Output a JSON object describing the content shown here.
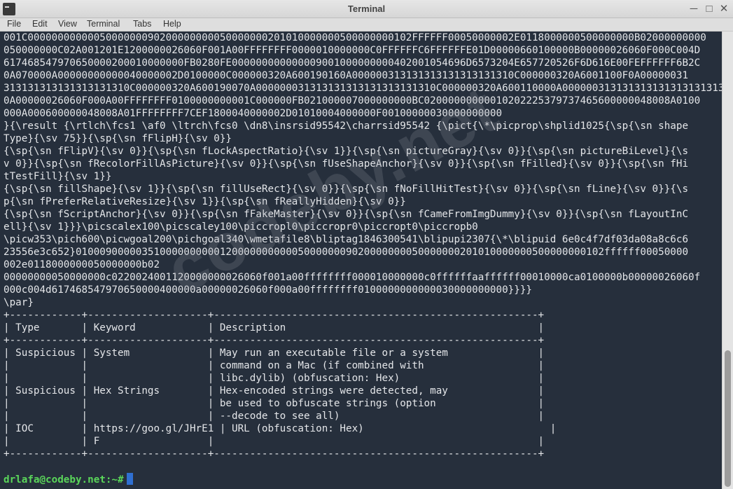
{
  "window": {
    "title": "Terminal",
    "controls": {
      "minimize": "─",
      "maximize": "□",
      "close": "✕"
    }
  },
  "menu": [
    "File",
    "Edit",
    "View",
    "Terminal",
    "Tabs",
    "Help"
  ],
  "terminal": {
    "lines": [
      "001C0000000000005000000090200000000050000000201010000000500000000102FFFFFF00050000002E0118000000500000000B02000000000",
      "050000000C02A001201E1200000026060F001A00FFFFFFFF0000010000000C0FFFFFFC6FFFFFFE01D00000660100000B00000026060F000C004D",
      "617468547970650000200010000000FB0280FE000000000000009001000000000402001054696D6573204E657720526F6D616E00FEFFFFFF6B2C",
      "0A070000A00000000000040000002D0100000C000000320A600190160A000000313131313131313131310C000000320A6001100F0A00000031",
      "313131313131313131310C000000320A600190070A000000031313131313131313131310C000000320A600110000A0000003131313131313131313131",
      "0A00000026060F000A00FFFFFFFF0100000000001C000000FB021000007000000000BC02000000000010202225379737465600000048008A0100",
      "000A000600000048008A01FFFFFFFF7CEF1800040000002D01010004000000F00100000030000000000",
      "}{\\result {\\rtlch\\fcs1 \\af0 \\ltrch\\fcs0 \\dn8\\insrsid95542\\charrsid95542 {\\pict{\\*\\picprop\\shplid1025{\\sp{\\sn shape",
      "Type}{\\sv 75}}{\\sp{\\sn fFlipH}{\\sv 0}}",
      "{\\sp{\\sn fFlipV}{\\sv 0}}{\\sp{\\sn fLockAspectRatio}{\\sv 1}}{\\sp{\\sn pictureGray}{\\sv 0}}{\\sp{\\sn pictureBiLevel}{\\s",
      "v 0}}{\\sp{\\sn fRecolorFillAsPicture}{\\sv 0}}{\\sp{\\sn fUseShapeAnchor}{\\sv 0}}{\\sp{\\sn fFilled}{\\sv 0}}{\\sp{\\sn fHi",
      "tTestFill}{\\sv 1}}",
      "{\\sp{\\sn fillShape}{\\sv 1}}{\\sp{\\sn fillUseRect}{\\sv 0}}{\\sp{\\sn fNoFillHitTest}{\\sv 0}}{\\sp{\\sn fLine}{\\sv 0}}{\\s",
      "p{\\sn fPreferRelativeResize}{\\sv 1}}{\\sp{\\sn fReallyHidden}{\\sv 0}}",
      "{\\sp{\\sn fScriptAnchor}{\\sv 0}}{\\sp{\\sn fFakeMaster}{\\sv 0}}{\\sp{\\sn fCameFromImgDummy}{\\sv 0}}{\\sp{\\sn fLayoutInC",
      "ell}{\\sv 1}}}\\picscalex100\\picscaley100\\piccropl0\\piccropr0\\piccropt0\\piccropb0",
      "\\picw353\\pich600\\picwgoal200\\pichgoal340\\wmetafile8\\bliptag1846300541\\blipupi2307{\\*\\blipuid 6e0c4f7df03da08a8c6c6",
      "23556e3c652}0100090000035100000000001200000000000500000009020000000050000000201010000000500000000102ffffff00050000",
      "002e0118000000050000000b02",
      "00000000050000000c0220024001120000000026060f001a00ffffffff000010000000c0ffffffaaffffff00010000ca0100000b00000026060f",
      "000c004d617468547970650000400000a00000026060f000a00ffffffff0100000000000030000000000}}}}",
      "\\par}",
      "+------------+--------------------+------------------------------------------------------+",
      "| Type       | Keyword            | Description                                          |",
      "+------------+--------------------+------------------------------------------------------+",
      "| Suspicious | System             | May run an executable file or a system               |",
      "|            |                    | command on a Mac (if combined with                   |",
      "|            |                    | libc.dylib) (obfuscation: Hex)                       |",
      "| Suspicious | Hex Strings        | Hex-encoded strings were detected, may               |",
      "|            |                    | be used to obfuscate strings (option                 |",
      "|            |                    | --decode to see all)                                 |",
      "| IOC        | https://goo.gl/JHrE1 | URL (obfuscation: Hex)                               |",
      "|            | F                  |                                                      |",
      "+------------+--------------------+------------------------------------------------------+"
    ],
    "prompt": "drlafa@codeby.net:~#"
  },
  "watermark": "codeby.net"
}
